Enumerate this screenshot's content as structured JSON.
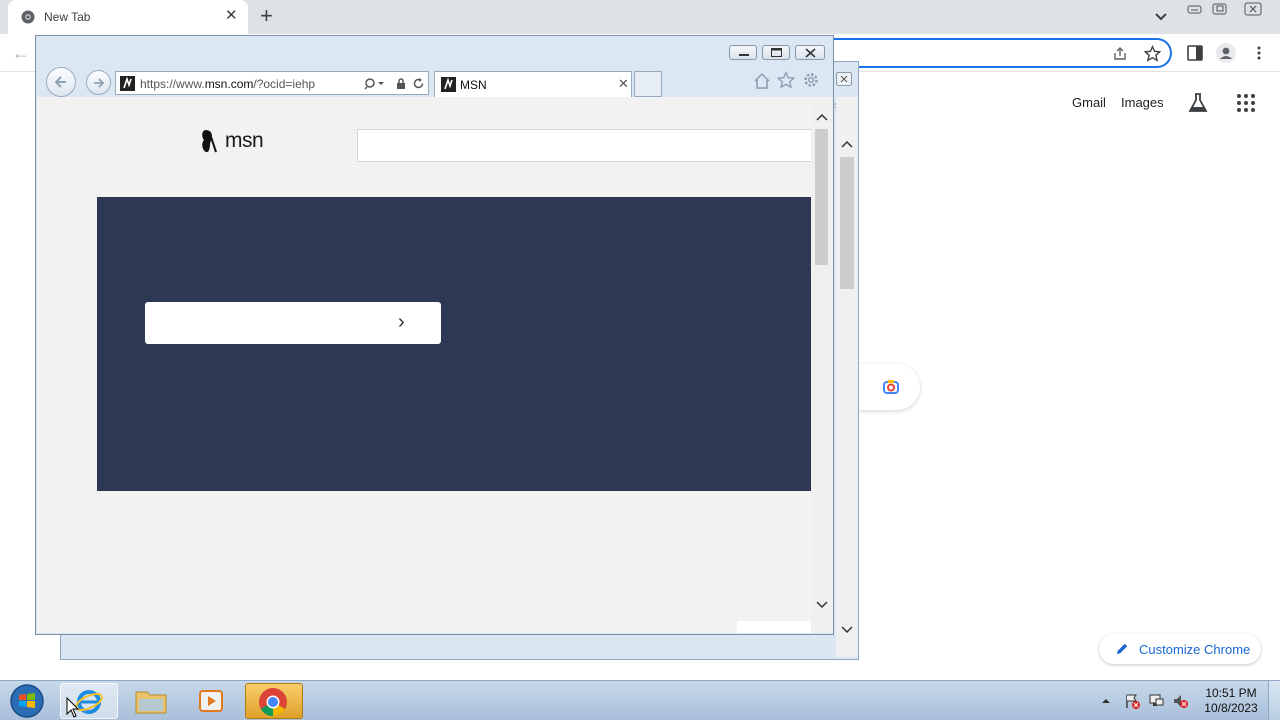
{
  "chrome": {
    "tab_title": "New Tab",
    "links": {
      "gmail": "Gmail",
      "images": "Images"
    },
    "customize_label": "Customize Chrome",
    "accent": "#1a73e8"
  },
  "ie": {
    "url_prefix": "https://www.",
    "url_domain": "msn.com",
    "url_rest": "/?ocid=iehp",
    "tab_title": "MSN",
    "hero_color": "#2c3854"
  },
  "msn": {
    "logo_text": "msn"
  },
  "taskbar": {
    "time": "10:51 PM",
    "date": "10/8/2023",
    "apps": [
      "internet-explorer",
      "file-explorer",
      "media-player",
      "chrome"
    ]
  }
}
